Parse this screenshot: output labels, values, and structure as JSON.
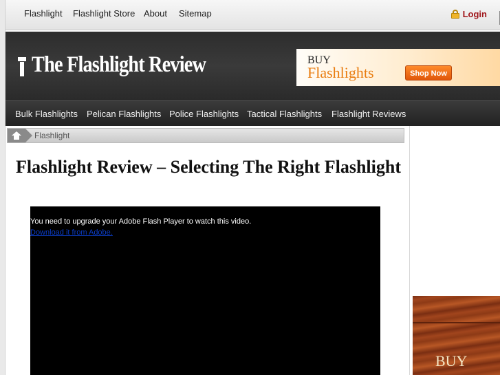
{
  "topnav": {
    "links": [
      "Flashlight",
      "Flashlight Store",
      "About",
      "Sitemap"
    ],
    "login": "Login"
  },
  "header": {
    "site_title": "The Flashlight Review",
    "ad": {
      "line1": "BUY",
      "line2": "Flashlights",
      "button": "Shop Now"
    }
  },
  "catnav": {
    "links": [
      "Bulk Flashlights",
      "Pelican Flashlights",
      "Police Flashlights",
      "Tactical Flashlights",
      "Flashlight Reviews"
    ]
  },
  "breadcrumb": {
    "current": "Flashlight"
  },
  "article": {
    "title": "Flashlight Review – Selecting The Right Flashlight"
  },
  "video": {
    "message": "You need to upgrade your Adobe Flash Player to watch this video.",
    "link": "Download it from Adobe."
  },
  "sidebar": {
    "ad_text": "BUY"
  },
  "colors": {
    "login": "#a0161b",
    "accent": "#e97d10",
    "link": "#0b3cc6"
  }
}
